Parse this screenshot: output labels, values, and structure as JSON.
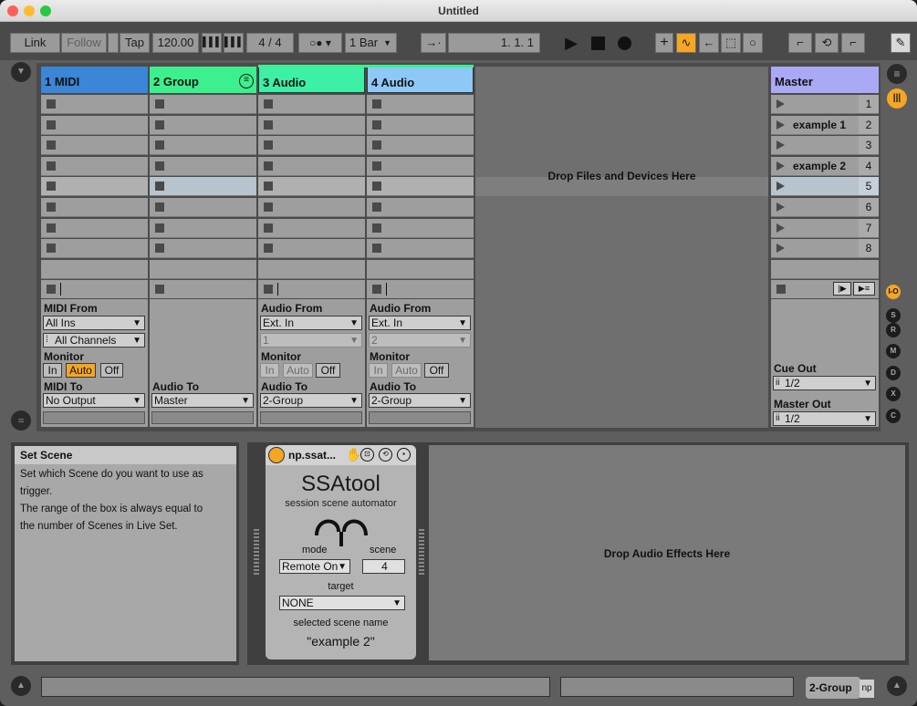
{
  "window": {
    "title": "Untitled"
  },
  "toolbar": {
    "link": "Link",
    "follow": "Follow",
    "tap": "Tap",
    "tempo": "120.00",
    "signature": "4 / 4",
    "quantize": "1 Bar",
    "position": "1.   1.   1"
  },
  "tracks": [
    {
      "name": "1 MIDI",
      "color": "#3b86d6"
    },
    {
      "name": "2 Group",
      "color": "#3cf08e"
    },
    {
      "name": "3 Audio",
      "color": "#3cf0a6"
    },
    {
      "name": "4 Audio",
      "color": "#8ec8f7"
    }
  ],
  "drop_devices": "Drop Files and Devices Here",
  "master": {
    "name": "Master",
    "color": "#a9a9f5",
    "scenes": [
      {
        "name": "",
        "num": "1"
      },
      {
        "name": "example 1",
        "num": "2"
      },
      {
        "name": "",
        "num": "3"
      },
      {
        "name": "example 2",
        "num": "4"
      },
      {
        "name": "",
        "num": "5"
      },
      {
        "name": "",
        "num": "6"
      },
      {
        "name": "",
        "num": "7"
      },
      {
        "name": "",
        "num": "8"
      }
    ],
    "cue_out_label": "Cue Out",
    "cue_out_value": "1/2",
    "master_out_label": "Master Out",
    "master_out_value": "1/2"
  },
  "io": {
    "midi": {
      "from_label": "MIDI From",
      "from_value": "All Ins",
      "channel": "All Channels",
      "monitor_label": "Monitor",
      "mon_in": "In",
      "mon_auto": "Auto",
      "mon_off": "Off",
      "to_label": "MIDI To",
      "to_value": "No Output"
    },
    "group": {
      "to_label": "Audio To",
      "to_value": "Master"
    },
    "audio3": {
      "from_label": "Audio From",
      "from_value": "Ext. In",
      "channel": "1",
      "monitor_label": "Monitor",
      "mon_in": "In",
      "mon_auto": "Auto",
      "mon_off": "Off",
      "to_label": "Audio To",
      "to_value": "2-Group"
    },
    "audio4": {
      "from_label": "Audio From",
      "from_value": "Ext. In",
      "channel": "2",
      "monitor_label": "Monitor",
      "mon_in": "In",
      "mon_auto": "Auto",
      "mon_off": "Off",
      "to_label": "Audio To",
      "to_value": "2-Group"
    }
  },
  "info": {
    "title": "Set Scene",
    "line1": "Set which Scene do you want to use as",
    "line2": "trigger.",
    "line3": "The range of the box is always equal to",
    "line4": "the number of Scenes in Live Set."
  },
  "device": {
    "name": "np.ssat...",
    "title": "SSAtool",
    "subtitle": "session scene automator",
    "mode_label": "mode",
    "mode_value": "Remote On",
    "scene_label": "scene",
    "scene_value": "4",
    "target_label": "target",
    "target_value": "NONE",
    "scene_name_label": "selected scene name",
    "scene_name_value": "\"example 2\""
  },
  "drop_effects": "Drop Audio Effects Here",
  "status": {
    "track": "2-Group",
    "tag": "np"
  }
}
